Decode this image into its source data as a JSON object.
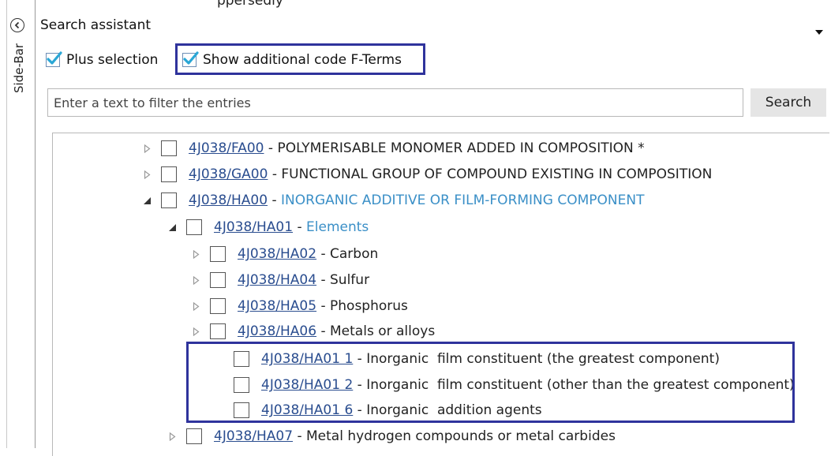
{
  "top_cut_text": "ppersedly",
  "sidebar": {
    "label": "Side-Bar",
    "collapse_icon": "chevron-left-circle-icon"
  },
  "panel": {
    "title": "Search assistant",
    "dropdown_icon": "caret-down-icon"
  },
  "options": {
    "plus_selection": {
      "label": "Plus selection",
      "checked": true
    },
    "show_additional": {
      "label": "Show additional code F-Terms",
      "checked": true
    }
  },
  "filter": {
    "placeholder": "Enter a text to filter the entries",
    "value": "",
    "search_label": "Search"
  },
  "colors": {
    "highlight_border": "#2f339c",
    "link": "#2a4d8f",
    "highlight_text": "#3a8fc7",
    "check": "#2aa7d6"
  },
  "tree": [
    {
      "code": "4J038/FA00",
      "sep": " - ",
      "desc": "POLYMERISABLE MONOMER ADDED IN COMPOSITION *",
      "expander": "collapsed",
      "highlight": false
    },
    {
      "code": "4J038/GA00",
      "sep": " - ",
      "desc": "FUNCTIONAL GROUP OF COMPOUND EXISTING IN COMPOSITION",
      "expander": "collapsed",
      "highlight": false
    },
    {
      "code": "4J038/HA00",
      "sep": " - ",
      "desc": "INORGANIC ADDITIVE OR FILM-FORMING COMPONENT",
      "expander": "expanded",
      "highlight": true
    },
    {
      "code": "4J038/HA01",
      "sep": " - ",
      "desc": "Elements",
      "expander": "expanded",
      "highlight": true
    },
    {
      "code": "4J038/HA02",
      "sep": " - ",
      "desc": "Carbon",
      "expander": "collapsed",
      "highlight": false
    },
    {
      "code": "4J038/HA04",
      "sep": " - ",
      "desc": "Sulfur",
      "expander": "collapsed",
      "highlight": false
    },
    {
      "code": "4J038/HA05",
      "sep": " - ",
      "desc": "Phosphorus",
      "expander": "collapsed",
      "highlight": false
    },
    {
      "code": "4J038/HA06",
      "sep": " - ",
      "desc": "Metals or alloys",
      "expander": "collapsed",
      "highlight": false
    },
    {
      "code": "4J038/HA01 1",
      "sep": " - ",
      "desc": "Inorganic  film constituent (the greatest component)",
      "expander": "none",
      "highlight": false
    },
    {
      "code": "4J038/HA01 2",
      "sep": " - ",
      "desc": "Inorganic  film constituent (other than the greatest component)",
      "expander": "none",
      "highlight": false
    },
    {
      "code": "4J038/HA01 6",
      "sep": " - ",
      "desc": "Inorganic  addition agents",
      "expander": "none",
      "highlight": false
    },
    {
      "code": "4J038/HA07",
      "sep": " - ",
      "desc": "Metal hydrogen compounds or metal carbides",
      "expander": "collapsed",
      "highlight": false
    }
  ]
}
